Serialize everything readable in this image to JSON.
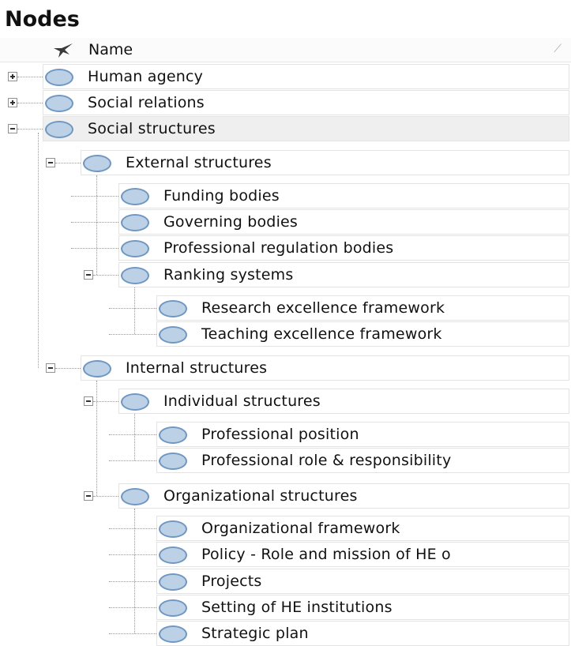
{
  "panel": {
    "title": "Nodes"
  },
  "column": {
    "name_header": "Name",
    "sort_glyph": "⟋",
    "header_icon": "star-icon"
  },
  "nodes": [
    {
      "label": "Human agency",
      "level": 0,
      "expander": "plus"
    },
    {
      "label": "Social relations",
      "level": 0,
      "expander": "plus"
    },
    {
      "label": "Social structures",
      "level": 0,
      "expander": "minus",
      "selected": true
    },
    {
      "label": "External structures",
      "level": 1,
      "expander": "minus"
    },
    {
      "label": "Funding bodies",
      "level": 2,
      "expander": "none"
    },
    {
      "label": "Governing bodies",
      "level": 2,
      "expander": "none"
    },
    {
      "label": "Professional regulation bodies",
      "level": 2,
      "expander": "none"
    },
    {
      "label": "Ranking systems",
      "level": 2,
      "expander": "minus"
    },
    {
      "label": "Research excellence framework",
      "level": 3,
      "expander": "none"
    },
    {
      "label": "Teaching excellence framework",
      "level": 3,
      "expander": "none"
    },
    {
      "label": "Internal structures",
      "level": 1,
      "expander": "minus"
    },
    {
      "label": "Individual structures",
      "level": 2,
      "expander": "minus"
    },
    {
      "label": "Professional position",
      "level": 3,
      "expander": "none"
    },
    {
      "label": "Professional role & responsibility",
      "level": 3,
      "expander": "none"
    },
    {
      "label": "Organizational structures",
      "level": 2,
      "expander": "minus"
    },
    {
      "label": "Organizational framework",
      "level": 3,
      "expander": "none"
    },
    {
      "label": "Policy - Role and mission of HE o",
      "level": 3,
      "expander": "none"
    },
    {
      "label": "Projects",
      "level": 3,
      "expander": "none"
    },
    {
      "label": "Setting of HE institutions",
      "level": 3,
      "expander": "none"
    },
    {
      "label": "Strategic plan",
      "level": 3,
      "expander": "none"
    }
  ],
  "colors": {
    "node_fill": "#bcd0e6",
    "node_border": "#6f97c2",
    "selected_row": "#efefef"
  }
}
